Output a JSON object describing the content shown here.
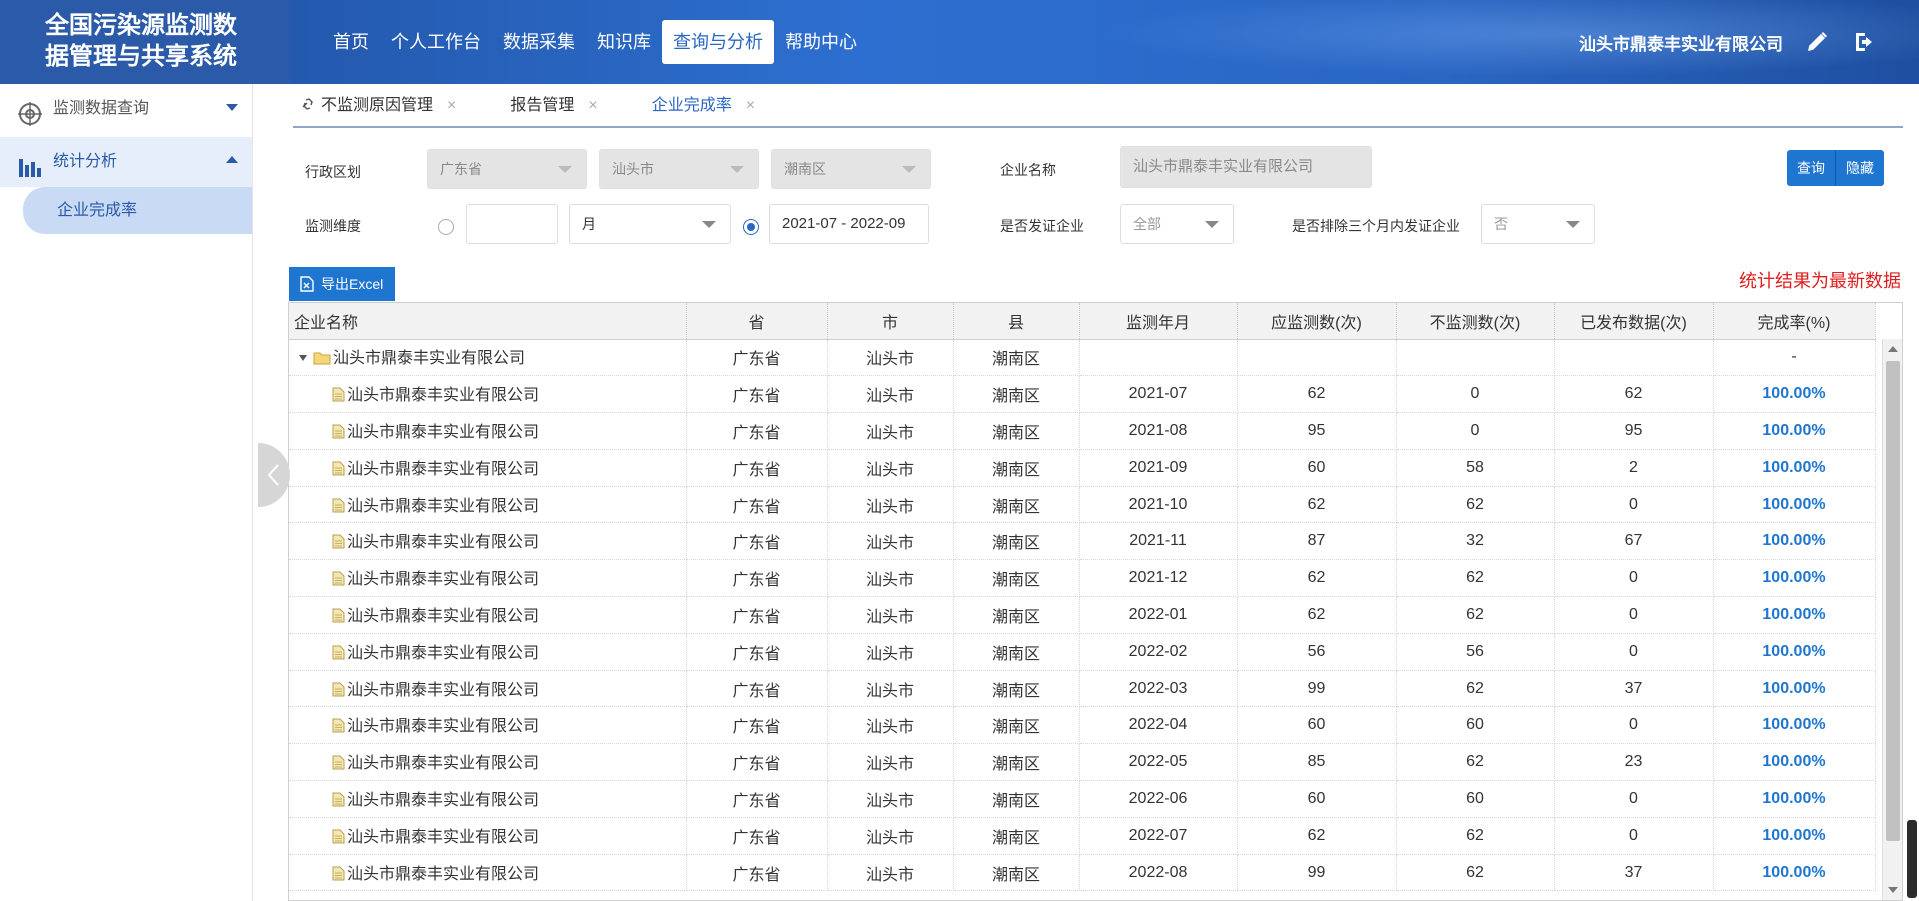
{
  "app": {
    "title_line1": "全国污染源监测数",
    "title_line2": "据管理与共享系统",
    "company": "汕头市鼎泰丰实业有限公司"
  },
  "nav": {
    "items": [
      "首页",
      "个人工作台",
      "数据采集",
      "知识库",
      "查询与分析",
      "帮助中心"
    ],
    "active": "查询与分析"
  },
  "sidebar": {
    "menu1": "监测数据查询",
    "menu2": "统计分析",
    "sub_active": "企业完成率"
  },
  "tabs": [
    {
      "label": "不监测原因管理",
      "close": "×"
    },
    {
      "label": "报告管理",
      "close": "×"
    },
    {
      "label": "企业完成率",
      "close": "×"
    }
  ],
  "filters": {
    "region_label": "行政区划",
    "province": "广东省",
    "city": "汕头市",
    "county": "潮南区",
    "company_label": "企业名称",
    "company_placeholder": "汕头市鼎泰丰实业有限公司",
    "dimension_label": "监测维度",
    "dimension_unit": "月",
    "date_range": "2021-07 - 2022-09",
    "license_label": "是否发证企业",
    "license_value": "全部",
    "exclude_label": "是否排除三个月内发证企业",
    "exclude_value": "否",
    "query_button": "查询",
    "hide_button": "隐藏"
  },
  "toolbar": {
    "export_label": "导出Excel",
    "notice": "统计结果为最新数据"
  },
  "table": {
    "columns": [
      "企业名称",
      "省",
      "市",
      "县",
      "监测年月",
      "应监测数(次)",
      "不监测数(次)",
      "已发布数据(次)",
      "完成率(%)"
    ],
    "parent": {
      "name": "汕头市鼎泰丰实业有限公司",
      "province": "广东省",
      "city": "汕头市",
      "county": "潮南区",
      "month": "",
      "expected": "",
      "not_monitored": "",
      "published": "",
      "rate": "-"
    },
    "rows": [
      {
        "name": "汕头市鼎泰丰实业有限公司",
        "province": "广东省",
        "city": "汕头市",
        "county": "潮南区",
        "month": "2021-07",
        "expected": "62",
        "not_monitored": "0",
        "published": "62",
        "rate": "100.00%"
      },
      {
        "name": "汕头市鼎泰丰实业有限公司",
        "province": "广东省",
        "city": "汕头市",
        "county": "潮南区",
        "month": "2021-08",
        "expected": "95",
        "not_monitored": "0",
        "published": "95",
        "rate": "100.00%"
      },
      {
        "name": "汕头市鼎泰丰实业有限公司",
        "province": "广东省",
        "city": "汕头市",
        "county": "潮南区",
        "month": "2021-09",
        "expected": "60",
        "not_monitored": "58",
        "published": "2",
        "rate": "100.00%"
      },
      {
        "name": "汕头市鼎泰丰实业有限公司",
        "province": "广东省",
        "city": "汕头市",
        "county": "潮南区",
        "month": "2021-10",
        "expected": "62",
        "not_monitored": "62",
        "published": "0",
        "rate": "100.00%"
      },
      {
        "name": "汕头市鼎泰丰实业有限公司",
        "province": "广东省",
        "city": "汕头市",
        "county": "潮南区",
        "month": "2021-11",
        "expected": "87",
        "not_monitored": "32",
        "published": "67",
        "rate": "100.00%"
      },
      {
        "name": "汕头市鼎泰丰实业有限公司",
        "province": "广东省",
        "city": "汕头市",
        "county": "潮南区",
        "month": "2021-12",
        "expected": "62",
        "not_monitored": "62",
        "published": "0",
        "rate": "100.00%"
      },
      {
        "name": "汕头市鼎泰丰实业有限公司",
        "province": "广东省",
        "city": "汕头市",
        "county": "潮南区",
        "month": "2022-01",
        "expected": "62",
        "not_monitored": "62",
        "published": "0",
        "rate": "100.00%"
      },
      {
        "name": "汕头市鼎泰丰实业有限公司",
        "province": "广东省",
        "city": "汕头市",
        "county": "潮南区",
        "month": "2022-02",
        "expected": "56",
        "not_monitored": "56",
        "published": "0",
        "rate": "100.00%"
      },
      {
        "name": "汕头市鼎泰丰实业有限公司",
        "province": "广东省",
        "city": "汕头市",
        "county": "潮南区",
        "month": "2022-03",
        "expected": "99",
        "not_monitored": "62",
        "published": "37",
        "rate": "100.00%"
      },
      {
        "name": "汕头市鼎泰丰实业有限公司",
        "province": "广东省",
        "city": "汕头市",
        "county": "潮南区",
        "month": "2022-04",
        "expected": "60",
        "not_monitored": "60",
        "published": "0",
        "rate": "100.00%"
      },
      {
        "name": "汕头市鼎泰丰实业有限公司",
        "province": "广东省",
        "city": "汕头市",
        "county": "潮南区",
        "month": "2022-05",
        "expected": "85",
        "not_monitored": "62",
        "published": "23",
        "rate": "100.00%"
      },
      {
        "name": "汕头市鼎泰丰实业有限公司",
        "province": "广东省",
        "city": "汕头市",
        "county": "潮南区",
        "month": "2022-06",
        "expected": "60",
        "not_monitored": "60",
        "published": "0",
        "rate": "100.00%"
      },
      {
        "name": "汕头市鼎泰丰实业有限公司",
        "province": "广东省",
        "city": "汕头市",
        "county": "潮南区",
        "month": "2022-07",
        "expected": "62",
        "not_monitored": "62",
        "published": "0",
        "rate": "100.00%"
      },
      {
        "name": "汕头市鼎泰丰实业有限公司",
        "province": "广东省",
        "city": "汕头市",
        "county": "潮南区",
        "month": "2022-08",
        "expected": "99",
        "not_monitored": "62",
        "published": "37",
        "rate": "100.00%"
      }
    ]
  },
  "colors": {
    "header_blue": "#2a66c4",
    "accent_blue": "#1f76d0",
    "notice_red": "#e01e1e"
  },
  "icons": {
    "sidebar_menu1": "target-icon",
    "sidebar_menu2": "bar-chart-icon",
    "tab_pin": "link-icon",
    "edit": "pencil-icon",
    "logout": "logout-icon",
    "export": "excel-icon",
    "folder": "folder-icon",
    "file": "file-icon"
  }
}
